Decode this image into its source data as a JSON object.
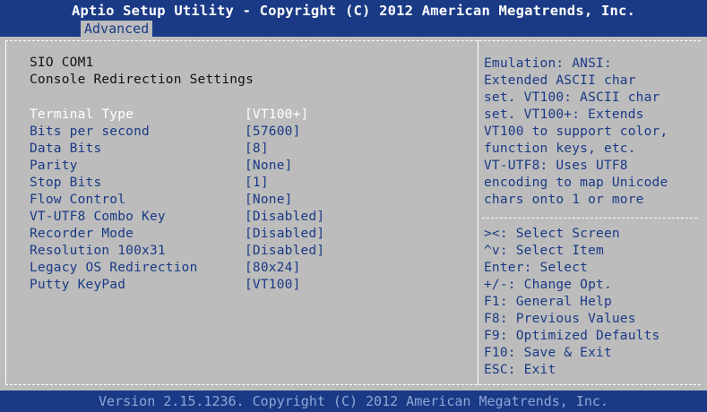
{
  "header": {
    "title": "Aptio Setup Utility - Copyright (C) 2012 American Megatrends, Inc.",
    "active_tab": "Advanced"
  },
  "section": {
    "title": "SIO COM1",
    "subtitle": "Console Redirection Settings"
  },
  "settings": [
    {
      "label": "Terminal Type",
      "value": "[VT100+]",
      "selected": true
    },
    {
      "label": "Bits per second",
      "value": "[57600]"
    },
    {
      "label": "Data Bits",
      "value": "[8]"
    },
    {
      "label": "Parity",
      "value": "[None]"
    },
    {
      "label": "Stop Bits",
      "value": "[1]"
    },
    {
      "label": "Flow Control",
      "value": "[None]"
    },
    {
      "label": "VT-UTF8 Combo Key",
      "value": "[Disabled]"
    },
    {
      "label": "Recorder Mode",
      "value": "[Disabled]"
    },
    {
      "label": "Resolution 100x31",
      "value": "[Disabled]"
    },
    {
      "label": "Legacy OS Redirection",
      "value": "[80x24]"
    },
    {
      "label": "Putty KeyPad",
      "value": "[VT100]"
    }
  ],
  "help_lines": [
    "Emulation: ANSI:",
    "Extended ASCII char",
    "set. VT100: ASCII char",
    "set. VT100+: Extends",
    "VT100 to support color,",
    "function keys, etc.",
    "VT-UTF8: Uses UTF8",
    "encoding to map Unicode",
    "chars onto 1 or more"
  ],
  "key_help": [
    "><: Select Screen",
    "^v: Select Item",
    "Enter: Select",
    "+/-: Change Opt.",
    "F1: General Help",
    "F8: Previous Values",
    "F9: Optimized Defaults",
    "F10: Save & Exit",
    "ESC: Exit"
  ],
  "footer": {
    "text": "Version 2.15.1236. Copyright (C) 2012 American Megatrends, Inc."
  }
}
